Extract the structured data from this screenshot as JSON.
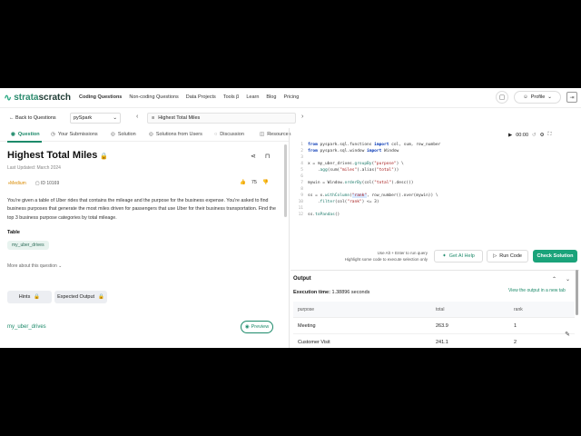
{
  "brand": {
    "name_a": "strata",
    "name_b": "scratch"
  },
  "nav": {
    "items": [
      "Coding Questions",
      "Non-coding Questions",
      "Data Projects",
      "Tools β",
      "Learn",
      "Blog",
      "Pricing"
    ],
    "profile_label": "Profile"
  },
  "subbar": {
    "back_label": "Back to Questions",
    "language": "pySpark",
    "question_name": "Highest Total Miles"
  },
  "tabs": [
    "Question",
    "Your Submissions",
    "Solution",
    "Solutions from Users",
    "Discussion",
    "Resources"
  ],
  "timer": "00:00",
  "question": {
    "title": "Highest Total Miles",
    "updated": "Last Updated: March 2024",
    "difficulty": "Medium",
    "id": "ID 10169",
    "votes": "75",
    "description": "You're given a table of Uber rides that contains the mileage and the purpose for the business expense.  You're asked to find business purposes that generate the most miles driven for passengers that use Uber for their business transportation. Find the top 3 business purpose categories by total mileage.",
    "table_label": "Table",
    "table_tag": "my_uber_drives",
    "more_about": "More about this question",
    "hints_label": "Hints",
    "expected_label": "Expected Output",
    "table_link": "my_uber_drives",
    "preview_label": "Preview"
  },
  "code": {
    "line_numbers": [
      "1",
      "2",
      "3",
      "4",
      "5",
      "6",
      "7",
      "8",
      "9",
      "10",
      "11",
      "12"
    ],
    "l1": [
      "from",
      " pyspark.sql.functions ",
      "import",
      " col, sum, row_number"
    ],
    "l2": [
      "from",
      " pyspark.sql.window ",
      "import",
      " Window"
    ],
    "l4a": "x = my_uber_drives.",
    "l4b": "groupBy",
    "l4c": "(",
    "l4d": "\"purpose\"",
    "l4e": ") \\",
    "l5a": "    .",
    "l5b": "agg",
    "l5c": "(sum(",
    "l5d": "\"miles\"",
    "l5e": ").alias(",
    "l5f": "\"total\"",
    "l5g": "))",
    "l7a": "mywin = Window.",
    "l7b": "orderBy",
    "l7c": "(col(",
    "l7d": "\"total\"",
    "l7e": ").desc())",
    "l9a": "ss = x.",
    "l9b": "withColumn",
    "l9c": "(",
    "l9d": "\"rank\"",
    "l9e": ", row_number().over(mywin)) \\",
    "l10a": "    .",
    "l10b": "filter",
    "l10c": "(col(",
    "l10d": "\"rank\"",
    "l10e": ") <= 3)",
    "l12a": "ss.",
    "l12b": "toPandas",
    "l12c": "()"
  },
  "editor_footer": {
    "hint_line1": "Use Alt + Enter to run query",
    "hint_line2": "Highlight some code to execute selection only",
    "ai_label": "Get AI Help",
    "run_label": "Run Code",
    "check_label": "Check Solution"
  },
  "output": {
    "title": "Output",
    "exec_label": "Execution time:",
    "exec_value": "1.38896 seconds",
    "view_new": "View the output in a new tab",
    "columns": [
      "purpose",
      "total",
      "rank"
    ],
    "rows": [
      [
        "Meeting",
        "263.9",
        "1"
      ],
      [
        "Customer Visit",
        "241.1",
        "2"
      ]
    ]
  }
}
